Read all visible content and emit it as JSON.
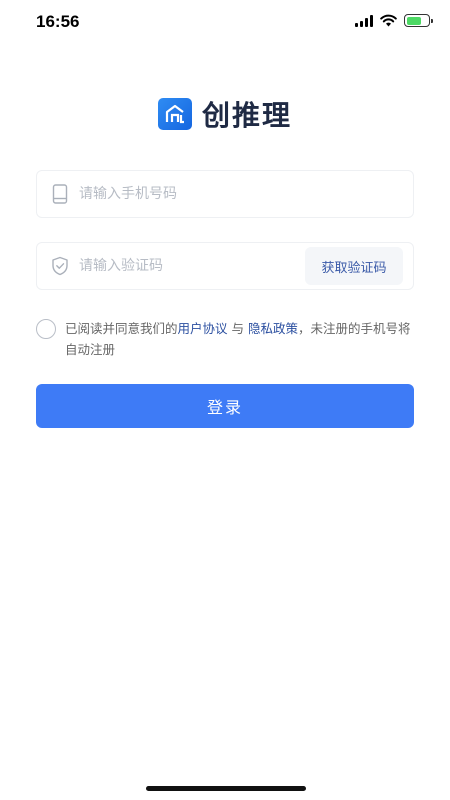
{
  "status_bar": {
    "time": "16:56"
  },
  "app": {
    "brand_name": "创推理"
  },
  "phone_field": {
    "placeholder": "请输入手机号码",
    "value": ""
  },
  "code_field": {
    "placeholder": "请输入验证码",
    "value": "",
    "get_code_label": "获取验证码"
  },
  "agreement": {
    "prefix": "已阅读并同意我们的",
    "user_agreement": "用户协议",
    "and": " 与 ",
    "privacy_policy": "隐私政策",
    "suffix": "，未注册的手机号将自动注册",
    "checked": false
  },
  "login_button": {
    "label": "登录"
  },
  "colors": {
    "primary": "#3e7bf6",
    "link": "#2b4fa0",
    "brand_dark": "#1f2a44"
  }
}
